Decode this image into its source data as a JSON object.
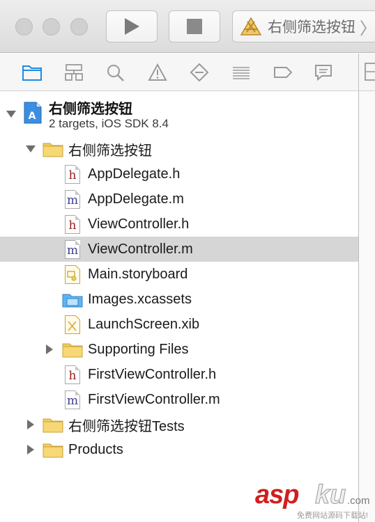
{
  "toolbar": {
    "scheme_name": "右侧筛选按钮",
    "scheme_chevron": "〉"
  },
  "navigator_tabs": [
    {
      "name": "project-navigator-icon",
      "selected": true
    },
    {
      "name": "symbol-navigator-icon",
      "selected": false
    },
    {
      "name": "find-navigator-icon",
      "selected": false
    },
    {
      "name": "issue-navigator-icon",
      "selected": false
    },
    {
      "name": "test-navigator-icon",
      "selected": false
    },
    {
      "name": "debug-navigator-icon",
      "selected": false
    },
    {
      "name": "breakpoint-navigator-icon",
      "selected": false
    },
    {
      "name": "report-navigator-icon",
      "selected": false
    }
  ],
  "project": {
    "name": "右侧筛选按钮",
    "subtitle": "2 targets, iOS SDK 8.4"
  },
  "tree": {
    "group_main": "右侧筛选按钮",
    "files": [
      {
        "label": "AppDelegate.h",
        "icon": "header-file-icon",
        "letter": "h"
      },
      {
        "label": "AppDelegate.m",
        "icon": "source-file-icon",
        "letter": "m"
      },
      {
        "label": "ViewController.h",
        "icon": "header-file-icon",
        "letter": "h"
      },
      {
        "label": "ViewController.m",
        "icon": "source-file-icon",
        "letter": "m",
        "selected": true
      },
      {
        "label": "Main.storyboard",
        "icon": "storyboard-file-icon"
      },
      {
        "label": "Images.xcassets",
        "icon": "asset-catalog-icon"
      },
      {
        "label": "LaunchScreen.xib",
        "icon": "xib-file-icon"
      },
      {
        "label": "Supporting Files",
        "icon": "folder-icon"
      },
      {
        "label": "FirstViewController.h",
        "icon": "header-file-icon",
        "letter": "h"
      },
      {
        "label": "FirstViewController.m",
        "icon": "source-file-icon",
        "letter": "m"
      }
    ],
    "group_tests": "右侧筛选按钮Tests",
    "group_products": "Products"
  },
  "watermark": {
    "asp": "asp",
    "ku": "ku",
    "com": ".com",
    "sub": "免费网站源码下载站!"
  },
  "colors": {
    "selection": "#d6d6d6",
    "folder": "#f2cd5c",
    "accent_blue": "#1d8ae6",
    "header_letter": "#9b1c1c",
    "source_letter": "#3d3d8e"
  }
}
